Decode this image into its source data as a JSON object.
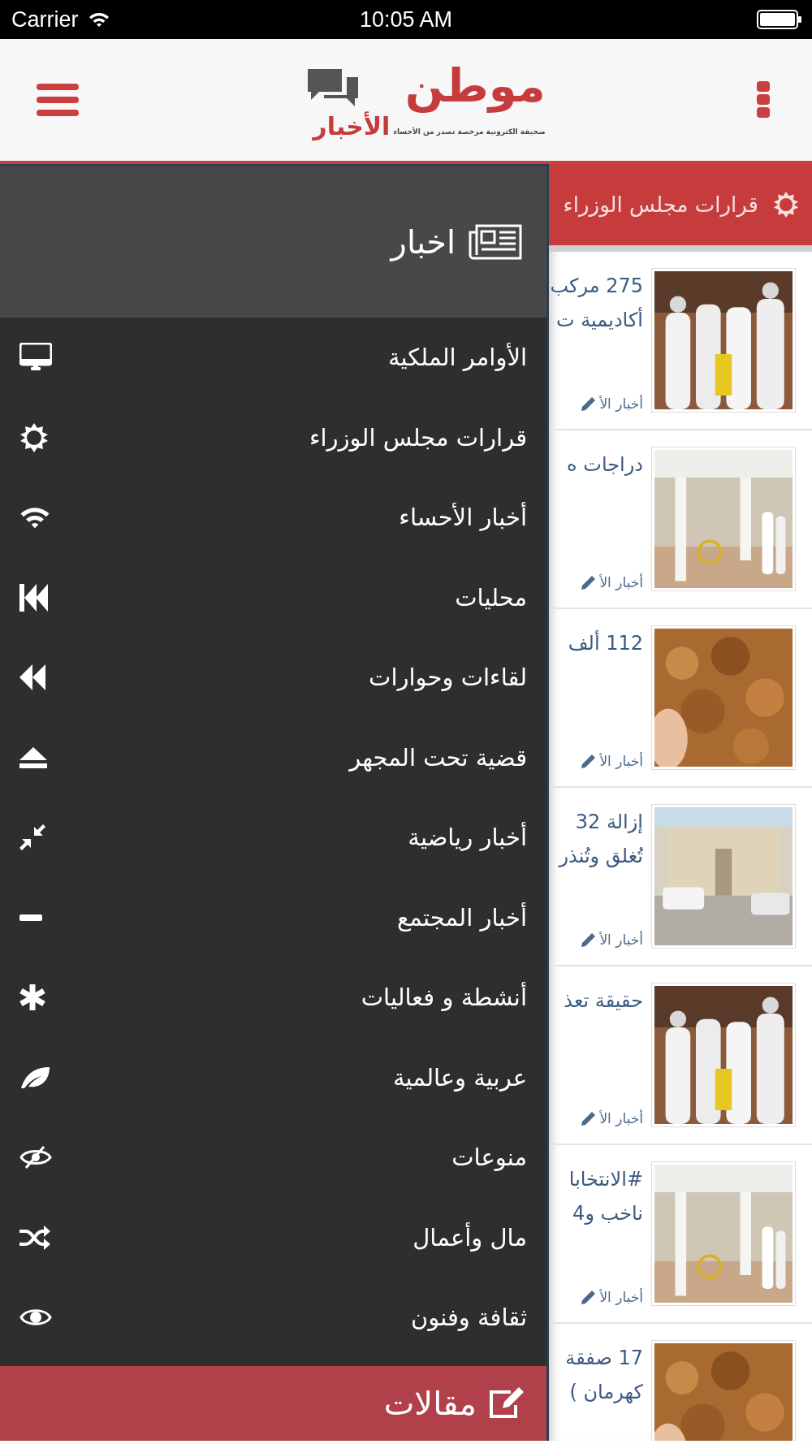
{
  "status_bar": {
    "carrier": "Carrier",
    "time": "10:05 AM"
  },
  "header": {
    "logo_main": "موطن",
    "logo_sub": "الأخبار",
    "tagline": "صحيفة الكترونية مرخصة تصدر من الأحساء"
  },
  "drawer": {
    "title": "اخبار",
    "items": [
      {
        "label": "الأوامر الملكية"
      },
      {
        "label": "قرارات مجلس الوزراء"
      },
      {
        "label": "أخبار الأحساء"
      },
      {
        "label": "محليات"
      },
      {
        "label": "لقاءات وحوارات"
      },
      {
        "label": "قضية تحت المجهر"
      },
      {
        "label": "أخبار رياضية"
      },
      {
        "label": "أخبار المجتمع"
      },
      {
        "label": "أنشطة و فعاليات"
      },
      {
        "label": "عربية وعالمية"
      },
      {
        "label": "منوعات"
      },
      {
        "label": "مال وأعمال"
      },
      {
        "label": "ثقافة وفنون"
      }
    ],
    "footer": "مقالات"
  },
  "section_bar": {
    "title": "قرارات مجلس الوزراء"
  },
  "news": [
    {
      "title_lines": [
        "275 مركب",
        "أكاديمية ت"
      ],
      "category": "أخبار الأ"
    },
    {
      "title_lines": [
        "دراجات ه"
      ],
      "category": "أخبار الأ"
    },
    {
      "title_lines": [
        "112 ألف"
      ],
      "category": "أخبار الأ"
    },
    {
      "title_lines": [
        "إزالة 32",
        "تُغلق وتُنذر"
      ],
      "category": "أخبار الأ"
    },
    {
      "title_lines": [
        "حقيقة تعذ"
      ],
      "category": "أخبار الأ"
    },
    {
      "title_lines": [
        "#الانتخابا",
        "ناخب و4"
      ],
      "category": "أخبار الأ"
    },
    {
      "title_lines": [
        "17 صفقة",
        "كهرمان )"
      ]
    }
  ]
}
